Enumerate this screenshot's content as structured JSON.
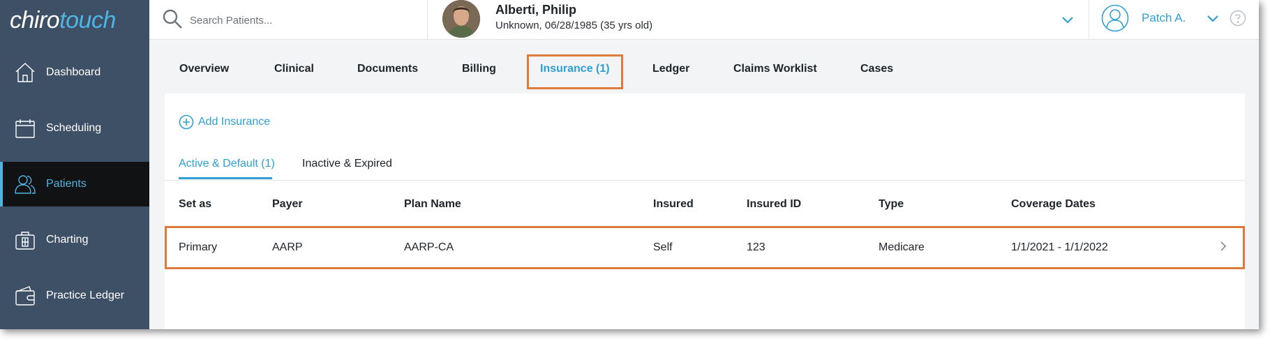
{
  "brand": {
    "part1": "chiro",
    "part2": "touch"
  },
  "sidebar": {
    "items": [
      {
        "label": "Dashboard",
        "icon": "home-icon"
      },
      {
        "label": "Scheduling",
        "icon": "calendar-icon"
      },
      {
        "label": "Patients",
        "icon": "users-icon",
        "active": true
      },
      {
        "label": "Charting",
        "icon": "medical-kit-icon"
      },
      {
        "label": "Practice Ledger",
        "icon": "wallet-icon"
      }
    ]
  },
  "header": {
    "search_placeholder": "Search Patients...",
    "patient_name": "Alberti, Philip",
    "patient_info": "Unknown, 06/28/1985 (35 yrs old)",
    "user_name": "Patch A."
  },
  "tabs": [
    {
      "label": "Overview"
    },
    {
      "label": "Clinical"
    },
    {
      "label": "Documents"
    },
    {
      "label": "Billing"
    },
    {
      "label": "Insurance (1)",
      "active": true
    },
    {
      "label": "Ledger"
    },
    {
      "label": "Claims Worklist"
    },
    {
      "label": "Cases"
    }
  ],
  "insurance": {
    "add_label": "Add Insurance",
    "subtabs": [
      {
        "label": "Active & Default (1)",
        "active": true
      },
      {
        "label": "Inactive & Expired"
      }
    ],
    "columns": [
      "Set as",
      "Payer",
      "Plan Name",
      "Insured",
      "Insured ID",
      "Type",
      "Coverage Dates"
    ],
    "rows": [
      [
        "Primary",
        "AARP",
        "AARP-CA",
        "Self",
        "123",
        "Medicare",
        "1/1/2021 - 1/1/2022"
      ]
    ]
  },
  "colors": {
    "accent": "#2e9fd3",
    "sidebar": "#3d5066",
    "sidebar_active": "#101214",
    "highlight": "#e07a3a"
  }
}
